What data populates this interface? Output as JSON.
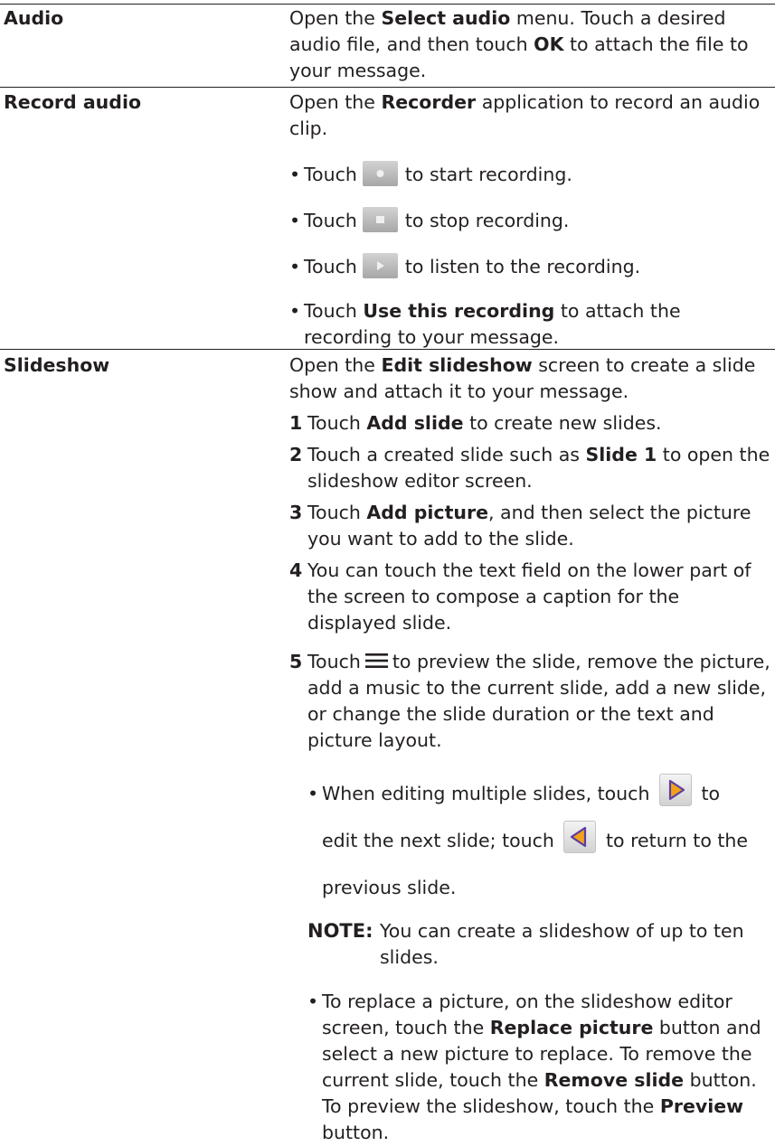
{
  "rows": {
    "audio": {
      "term": "Audio",
      "desc": [
        "Open the ",
        "Select audio",
        " menu. Touch a desired audio file, and then touch ",
        "OK",
        " to attach the file to your message."
      ]
    },
    "record_audio": {
      "term": "Record audio",
      "desc": [
        "Open the ",
        "Recorder",
        " application to record an audio clip."
      ],
      "bullets": [
        {
          "pre": "Touch",
          "icon": "record-icon",
          "post": "to start recording."
        },
        {
          "pre": "Touch",
          "icon": "stop-icon",
          "post": "to stop recording."
        },
        {
          "pre": "Touch",
          "icon": "play-icon",
          "post": "to listen to the recording."
        },
        {
          "pre": "Touch ",
          "bold": "Use this recording",
          "post": " to attach the recording to your message."
        }
      ]
    },
    "slideshow": {
      "term": "Slideshow",
      "desc": [
        "Open the ",
        "Edit slideshow",
        " screen to create a slide show and attach it to your message."
      ],
      "steps": [
        {
          "num": "1",
          "parts": [
            "Touch ",
            "Add slide",
            " to create new slides."
          ]
        },
        {
          "num": "2",
          "parts": [
            "Touch a created slide such as ",
            "Slide 1",
            " to open the slideshow editor screen."
          ]
        },
        {
          "num": "3",
          "parts": [
            "Touch ",
            "Add picture",
            ", and then select the picture you want to add to the slide."
          ]
        },
        {
          "num": "4",
          "text": "You can touch the text field on the lower part of the screen to compose a caption for the displayed slide."
        },
        {
          "num": "5",
          "pre": "Touch",
          "icon": "menu-icon",
          "post": "to preview the slide, remove the picture, add a music to the current slide, add a new slide, or change the slide duration or the text and picture layout."
        }
      ],
      "sub_bullet_1": {
        "pre": "When editing multiple slides, touch",
        "icon_next": "next-slide-icon",
        "mid_a": "to",
        "mid_b": "edit the next slide; touch",
        "icon_prev": "previous-slide-icon",
        "post_a": "to return to the",
        "post_b": "previous slide."
      },
      "note": {
        "label": "NOTE:",
        "text": "You can create a slideshow of up to ten slides."
      },
      "sub_bullet_2": [
        "To replace a picture, on the slideshow editor screen, touch the ",
        "Replace picture",
        " button and select a new picture to replace. To remove the current slide, touch the ",
        "Remove slide",
        " button. To preview the slideshow, touch the ",
        "Preview",
        " button."
      ]
    }
  },
  "bullet_char": "•",
  "colors": {
    "text": "#231f20",
    "rule": "#231f20",
    "nav_arrow_fill": "#f2a21a",
    "nav_arrow_outline": "#5b3fa3"
  }
}
